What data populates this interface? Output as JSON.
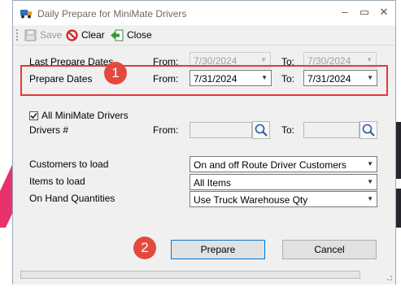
{
  "window": {
    "title": "Daily Prepare for MiniMate Drivers",
    "minimize": "–",
    "maximize": "▭",
    "close": "✕"
  },
  "toolbar": {
    "save_label": "Save",
    "clear_label": "Clear",
    "close_label": "Close"
  },
  "form": {
    "last_prepare": {
      "label": "Last Prepare Dates",
      "from_label": "From:",
      "from_value": "7/30/2024",
      "to_label": "To:",
      "to_value": "7/30/2024"
    },
    "prepare": {
      "label": "Prepare Dates",
      "from_label": "From:",
      "from_value": "7/31/2024",
      "to_label": "To:",
      "to_value": "7/31/2024"
    },
    "all_drivers": {
      "label": "All MiniMate Drivers",
      "checked": true
    },
    "drivers": {
      "label": "Drivers #",
      "from_label": "From:",
      "from_value": "",
      "to_label": "To:",
      "to_value": ""
    },
    "customers": {
      "label": "Customers to load",
      "value": "On and off Route Driver Customers"
    },
    "items": {
      "label": "Items to load",
      "value": "All Items"
    },
    "on_hand": {
      "label": "On Hand Quantities",
      "value": "Use Truck Warehouse Qty"
    }
  },
  "annotations": {
    "badge_1": "1",
    "badge_2": "2"
  },
  "buttons": {
    "prepare_label": "Prepare",
    "cancel_label": "Cancel"
  },
  "progress": {
    "fraction": 0
  },
  "colors": {
    "highlight": "#e4383c",
    "badge": "#e34a3e",
    "default_button_border": "#0078d7"
  }
}
